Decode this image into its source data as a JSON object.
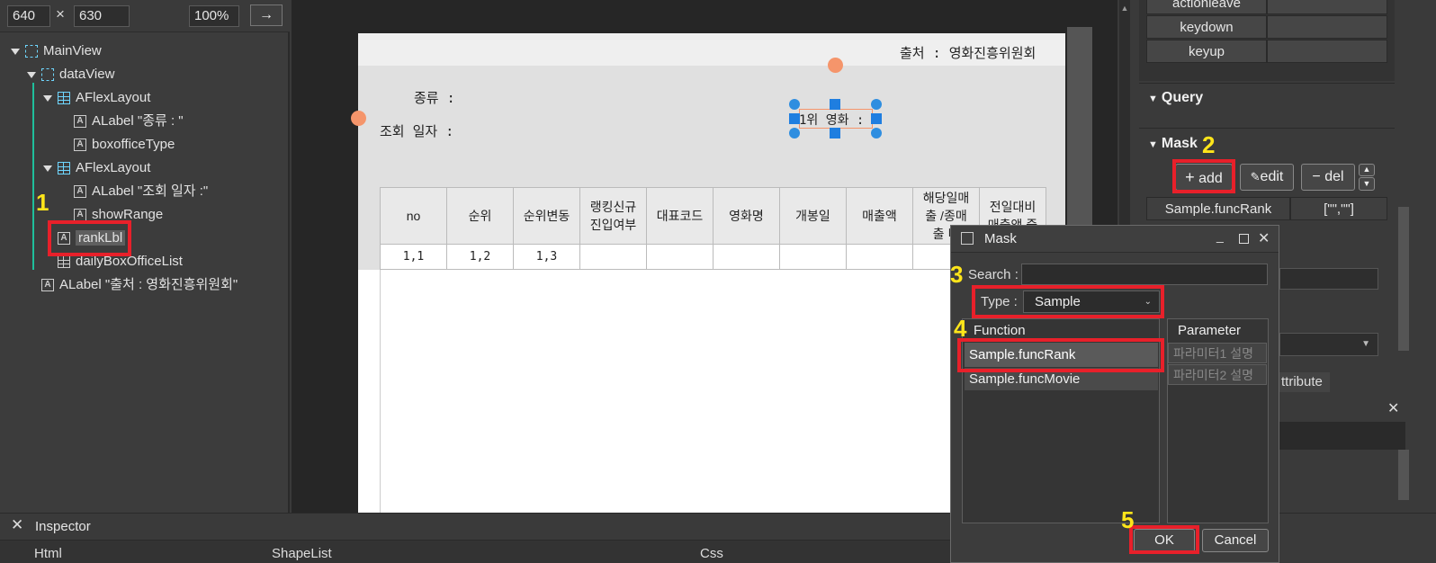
{
  "toolbar": {
    "width": "640",
    "times": "×",
    "height": "630",
    "zoom": "100%",
    "arrow": "→"
  },
  "tree": {
    "items": [
      {
        "label": "MainView"
      },
      {
        "label": "dataView"
      },
      {
        "label": "AFlexLayout"
      },
      {
        "label": "ALabel \"종류 : \""
      },
      {
        "label": "boxofficeType"
      },
      {
        "label": "AFlexLayout"
      },
      {
        "label": "ALabel \"조회 일자 :\""
      },
      {
        "label": "showRange"
      },
      {
        "label": "rankLbl"
      },
      {
        "label": "dailyBoxOfficeList"
      },
      {
        "label": "ALabel \"출처 : 영화진흥위원회\""
      }
    ],
    "icon_letter": "A"
  },
  "page": {
    "source": "출처 : 영화진흥위원회",
    "type_label": "종류 :",
    "date_label": "조회 일자 :",
    "rank_label": "1위 영화 :",
    "headers": [
      "no",
      "순위",
      "순위변동",
      "랭킹신규\n진입여부",
      "대표코드",
      "영화명",
      "개봉일",
      "매출액",
      "해당일매\n출 /종매\n출 비",
      "전일대비\n매출액 증"
    ],
    "row": [
      "1,1",
      "1,2",
      "1,3",
      "",
      "",
      "",
      "",
      "",
      "",
      ""
    ]
  },
  "right": {
    "events": [
      {
        "name": "actionleave"
      },
      {
        "name": "keydown"
      },
      {
        "name": "keyup"
      }
    ],
    "query_title": "Query",
    "mask_title": "Mask",
    "add": "add",
    "edit": "edit",
    "del": "del",
    "mask_func": "Sample.funcRank",
    "mask_param": "[\"\",\"\"]",
    "attribute_tab": "ttribute"
  },
  "dialog": {
    "title": "Mask",
    "search_label": "Search :",
    "type_label": "Type :",
    "type_value": "Sample",
    "function_header": "Function",
    "parameter_header": "Parameter",
    "functions": [
      "Sample.funcRank",
      "Sample.funcMovie"
    ],
    "params": [
      "파라미터1 설명",
      "파라미터2 설명"
    ],
    "ok": "OK",
    "cancel": "Cancel"
  },
  "inspector": {
    "title": "Inspector",
    "tab1": "Html",
    "tab2": "ShapeList",
    "tab3": "Css"
  },
  "annotations": [
    "1",
    "2",
    "3",
    "4",
    "5"
  ],
  "colors": {
    "highlight": "#e8202a",
    "annotation": "#ffe51a",
    "selection": "#2f8ee0",
    "tree_line": "#1fbf9c"
  }
}
